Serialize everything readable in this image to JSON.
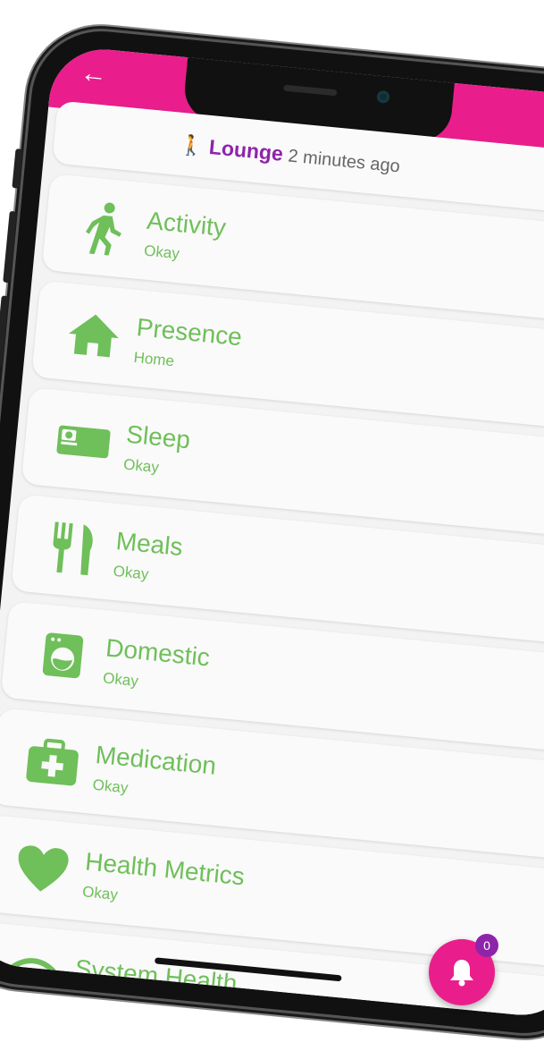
{
  "colors": {
    "topbar": "#e91e8c",
    "accent_green": "#6fbf5a",
    "room_purple": "#8e24aa",
    "fab": "#e91e8c"
  },
  "header": {
    "back_icon": "arrow-left-icon",
    "room": "Lounge",
    "time_ago": "2 minutes ago",
    "activity_icon": "walking-person-icon"
  },
  "items": [
    {
      "icon": "walking-person-icon",
      "title": "Activity",
      "status": "Okay"
    },
    {
      "icon": "home-icon",
      "title": "Presence",
      "status": "Home"
    },
    {
      "icon": "bed-icon",
      "title": "Sleep",
      "status": "Okay"
    },
    {
      "icon": "utensils-icon",
      "title": "Meals",
      "status": "Okay"
    },
    {
      "icon": "washing-machine-icon",
      "title": "Domestic",
      "status": "Okay"
    },
    {
      "icon": "first-aid-kit-icon",
      "title": "Medication",
      "status": "Okay"
    },
    {
      "icon": "heart-icon",
      "title": "Health Metrics",
      "status": "Okay"
    },
    {
      "icon": "wifi-icon",
      "title": "System Health",
      "status": ""
    }
  ],
  "notifications": {
    "icon": "bell-icon",
    "count": "0"
  }
}
